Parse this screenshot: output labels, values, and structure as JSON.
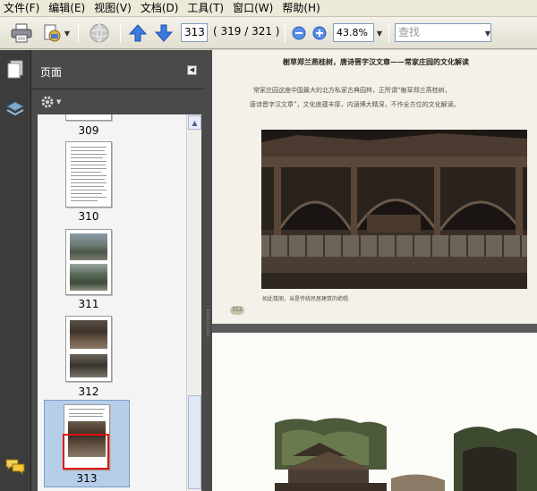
{
  "menu": {
    "items": [
      "文件(F)",
      "编辑(E)",
      "视图(V)",
      "文档(D)",
      "工具(T)",
      "窗口(W)",
      "帮助(H)"
    ]
  },
  "toolbar": {
    "page_number": "313",
    "page_count": "( 319 / 321 )",
    "zoom": "43.8%",
    "search_placeholder": "查找"
  },
  "panel": {
    "title": "页面",
    "thumbnails": [
      {
        "label": "309"
      },
      {
        "label": "310"
      },
      {
        "label": "311"
      },
      {
        "label": "312"
      },
      {
        "label": "313"
      }
    ]
  },
  "document": {
    "page_title": "榭草郑兰燕桂树，唐诗晋字汉文章——常家庄园的文化解读",
    "paragraph_line1": "常家庄园这座中国最大的北方私家古典园林，正所谓“榭草郑兰燕桂树，",
    "paragraph_line2": "唐诗晋字汉文章”，文化底蕴丰厚，内涵博大精深，不作全方位的文化解读。",
    "photo_caption": "如此楼阁，当是传统民居建筑的绝唱",
    "page_number_mark": "312"
  },
  "colors": {
    "panel_dark": "#4a4a4a",
    "selection_blue": "#b6cee8",
    "viewbox_red": "#e01010",
    "doc_background": "#5b5b5b"
  }
}
